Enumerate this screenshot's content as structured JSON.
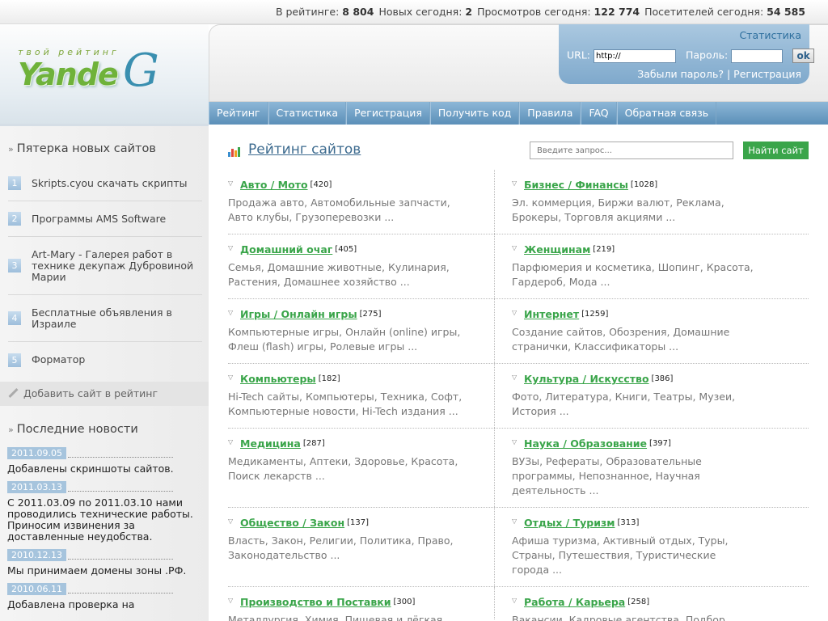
{
  "topbar": {
    "rating_label": "В рейтинге:",
    "rating_value": "8 804",
    "new_label": "Новых сегодня:",
    "new_value": "2",
    "views_label": "Просмотров сегодня:",
    "views_value": "122 774",
    "visitors_label": "Посетителей сегодня:",
    "visitors_value": "54 585"
  },
  "logo": {
    "tagline": "твой рейтинг",
    "word": "Yande",
    "letter": "G"
  },
  "login": {
    "stat_link": "Статистика",
    "url_label": "URL:",
    "url_value": "http://",
    "password_label": "Пароль:",
    "password_value": "",
    "ok_label": "ok",
    "forgot_label": "Забыли пароль?",
    "separator": "|",
    "register_label": "Регистрация"
  },
  "nav": [
    "Рейтинг",
    "Статистика",
    "Регистрация",
    "Получить код",
    "Правила",
    "FAQ",
    "Обратная связь"
  ],
  "sidebar": {
    "new_sites_heading": "Пятерка новых сайтов",
    "new_sites": [
      {
        "num": "1",
        "title": "Skripts.cyou скачать скрипты"
      },
      {
        "num": "2",
        "title": "Программы AMS Software"
      },
      {
        "num": "3",
        "title": "Art-Mary - Галерея работ в технике декупаж Дубровиной Марии"
      },
      {
        "num": "4",
        "title": "Бесплатные объявления в Израиле"
      },
      {
        "num": "5",
        "title": "Форматор"
      }
    ],
    "add_site_label": "Добавить сайт в рейтинг",
    "news_heading": "Последние новости",
    "news": [
      {
        "date": "2011.09.05",
        "text": "Добавлены скриншоты сайтов."
      },
      {
        "date": "2011.03.13",
        "text": "С 2011.03.09 по 2011.03.10 нами проводились технические работы. Приносим извинения за доставленные неудобства."
      },
      {
        "date": "2010.12.13",
        "text": "Мы принимаем домены зоны .РФ."
      },
      {
        "date": "2010.06.11",
        "text": "Добавлена проверка на"
      }
    ]
  },
  "main": {
    "title": "Рейтинг сайтов",
    "search_placeholder": "Введите запрос...",
    "search_button": "Найти сайт",
    "categories": [
      {
        "name": "Авто / Мото",
        "count": "[420]",
        "desc": "Продажа авто, Автомобильные запчасти, Авто клубы, Грузоперевозки ..."
      },
      {
        "name": "Бизнес / Финансы",
        "count": "[1028]",
        "desc": "Эл. коммерция, Биржи валют, Реклама, Брокеры, Торговля акциями ..."
      },
      {
        "name": "Домашний очаг",
        "count": "[405]",
        "desc": "Семья, Домашние животные, Кулинария, Растения, Домашнее хозяйство ..."
      },
      {
        "name": "Женщинам",
        "count": "[219]",
        "desc": "Парфюмерия и косметика, Шопинг, Красота, Гардероб, Мода ..."
      },
      {
        "name": "Игры / Онлайн игры",
        "count": "[275]",
        "desc": "Компьютерные игры, Онлайн (online) игры, Флеш (flash) игры, Ролевые игры ..."
      },
      {
        "name": "Интернет",
        "count": "[1259]",
        "desc": "Создание сайтов, Обозрения, Домашние странички, Классификаторы ..."
      },
      {
        "name": "Компьютеры",
        "count": "[182]",
        "desc": "Hi-Tech сайты, Компьютеры, Техника, Софт, Компьютерные новости, Hi-Tech издания ..."
      },
      {
        "name": "Культура / Искусство",
        "count": "[386]",
        "desc": "Фото, Литература, Книги, Театры, Музеи, История ..."
      },
      {
        "name": "Медицина",
        "count": "[287]",
        "desc": "Медикаменты, Аптеки, Здоровье, Красота, Поиск лекарств ..."
      },
      {
        "name": "Наука / Образование",
        "count": "[397]",
        "desc": "ВУЗы, Рефераты, Образовательные программы, Непознанное, Научная деятельность ..."
      },
      {
        "name": "Общество / Закон",
        "count": "[137]",
        "desc": "Власть, Закон, Религии, Политика, Право, Законодательство ..."
      },
      {
        "name": "Отдых / Туризм",
        "count": "[313]",
        "desc": "Афиша туризма, Активный отдых, Туры, Страны, Путешествия, Туристические города ..."
      },
      {
        "name": "Производство и Поставки",
        "count": "[300]",
        "desc": "Металлургия, Химия, Пищевая и лёгкая"
      },
      {
        "name": "Работа / Карьера",
        "count": "[258]",
        "desc": "Вакансии, Кадровые агентства, Подбор"
      }
    ]
  }
}
